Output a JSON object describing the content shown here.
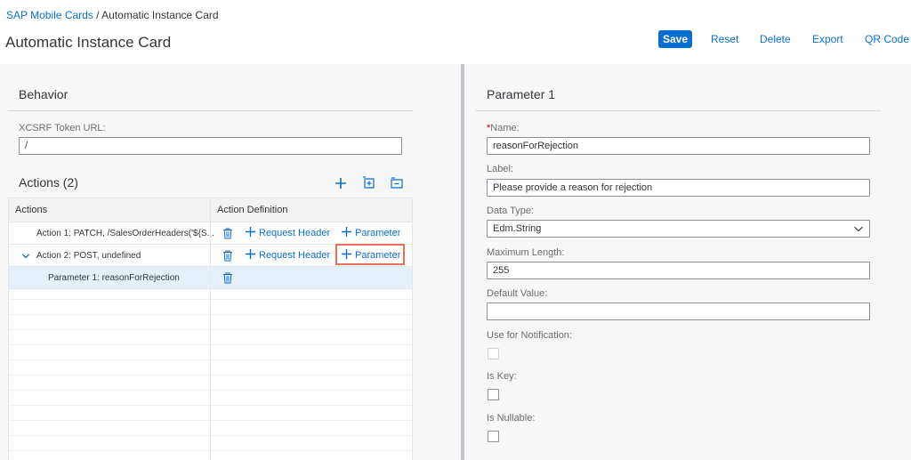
{
  "breadcrumb": {
    "root": "SAP Mobile Cards",
    "separator": " / ",
    "current": "Automatic Instance Card"
  },
  "page_title": "Automatic Instance Card",
  "header_actions": {
    "save": "Save",
    "reset": "Reset",
    "delete": "Delete",
    "export": "Export",
    "qr": "QR Code"
  },
  "behavior": {
    "title": "Behavior",
    "xcsrf_label": "XCSRF Token URL:",
    "xcsrf_value": "/"
  },
  "actions": {
    "title": "Actions (2)",
    "toolbar_icons": [
      "add-icon",
      "add-child-icon",
      "collapse-icon"
    ],
    "columns": [
      "Actions",
      "Action Definition"
    ],
    "rows": [
      {
        "label": "Action 1: PATCH, /SalesOrderHeaders('${S...",
        "expandable": false,
        "request_header": "Request Header",
        "parameter": "Parameter"
      },
      {
        "label": "Action 2: POST, undefined",
        "expandable": true,
        "expanded": true,
        "request_header": "Request Header",
        "parameter": "Parameter"
      },
      {
        "label": "Parameter 1: reasonForRejection",
        "selected": true
      }
    ]
  },
  "parameter": {
    "title": "Parameter 1",
    "name_label": "Name:",
    "name_required_marker": "*",
    "name_value": "reasonForRejection",
    "label_label": "Label:",
    "label_value": "Please provide a reason for rejection",
    "data_type_label": "Data Type:",
    "data_type_value": "Edm.String",
    "max_length_label": "Maximum Length:",
    "max_length_value": "255",
    "default_label": "Default Value:",
    "default_value": "",
    "notification_label": "Use for Notification:",
    "notification_checked": false,
    "is_key_label": "Is Key:",
    "is_key_checked": false,
    "is_nullable_label": "Is Nullable:",
    "is_nullable_checked": false
  },
  "colors": {
    "accent": "#0a6ed1",
    "highlight": "#e8705b",
    "required": "#bb0000"
  }
}
